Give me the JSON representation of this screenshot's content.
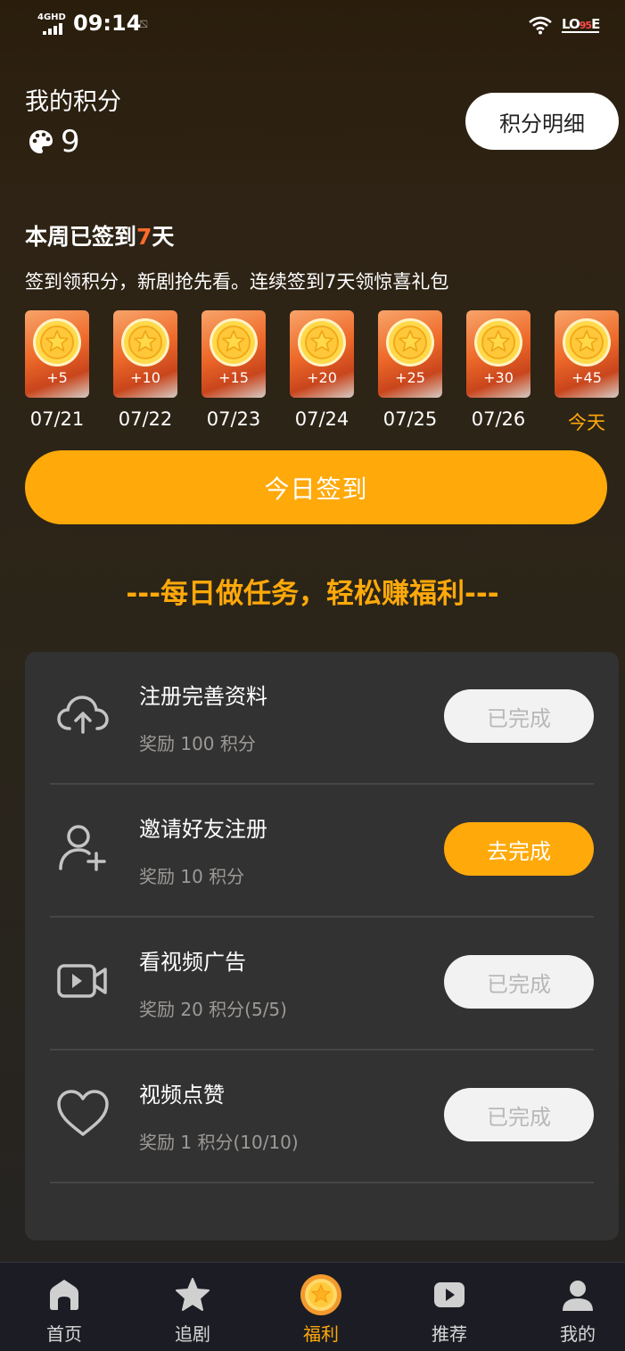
{
  "status_bar": {
    "network": "4GHD",
    "time": "09:14",
    "battery_text": "LO",
    "battery_level": "95",
    "battery_suffix": "E"
  },
  "points": {
    "label": "我的积分",
    "value": "9",
    "icon": "palette-icon",
    "detail_button": "积分明细"
  },
  "checkin": {
    "title_prefix": "本周已签到",
    "title_count": "7",
    "title_suffix": "天",
    "description": "签到领积分，新剧抢先看。连续签到7天领惊喜礼包",
    "days": [
      {
        "reward": "+5",
        "date": "07/21"
      },
      {
        "reward": "+10",
        "date": "07/22"
      },
      {
        "reward": "+15",
        "date": "07/23"
      },
      {
        "reward": "+20",
        "date": "07/24"
      },
      {
        "reward": "+25",
        "date": "07/25"
      },
      {
        "reward": "+30",
        "date": "07/26"
      },
      {
        "reward": "+45",
        "date": "今天"
      }
    ],
    "button": "今日签到"
  },
  "tasks": {
    "heading": "---每日做任务，轻松赚福利---",
    "items": [
      {
        "icon": "cloud-upload-icon",
        "title": "注册完善资料",
        "reward": "奖励 100 积分",
        "button": "已完成",
        "status": "done"
      },
      {
        "icon": "add-user-icon",
        "title": "邀请好友注册",
        "reward": "奖励 10 积分",
        "button": "去完成",
        "status": "todo"
      },
      {
        "icon": "video-play-icon",
        "title": "看视频广告",
        "reward": "奖励 20 积分(5/5)",
        "button": "已完成",
        "status": "done"
      },
      {
        "icon": "heart-icon",
        "title": "视频点赞",
        "reward": "奖励 1 积分(10/10)",
        "button": "已完成",
        "status": "done"
      }
    ]
  },
  "nav": {
    "items": [
      {
        "label": "首页",
        "icon": "home-icon"
      },
      {
        "label": "追剧",
        "icon": "star-icon"
      },
      {
        "label": "福利",
        "icon": "coin-star-icon",
        "active": true
      },
      {
        "label": "推荐",
        "icon": "play-icon"
      },
      {
        "label": "我的",
        "icon": "user-icon"
      }
    ]
  },
  "colors": {
    "accent": "#ffa90a",
    "highlight": "#ff6a2b",
    "panel": "#333232"
  }
}
